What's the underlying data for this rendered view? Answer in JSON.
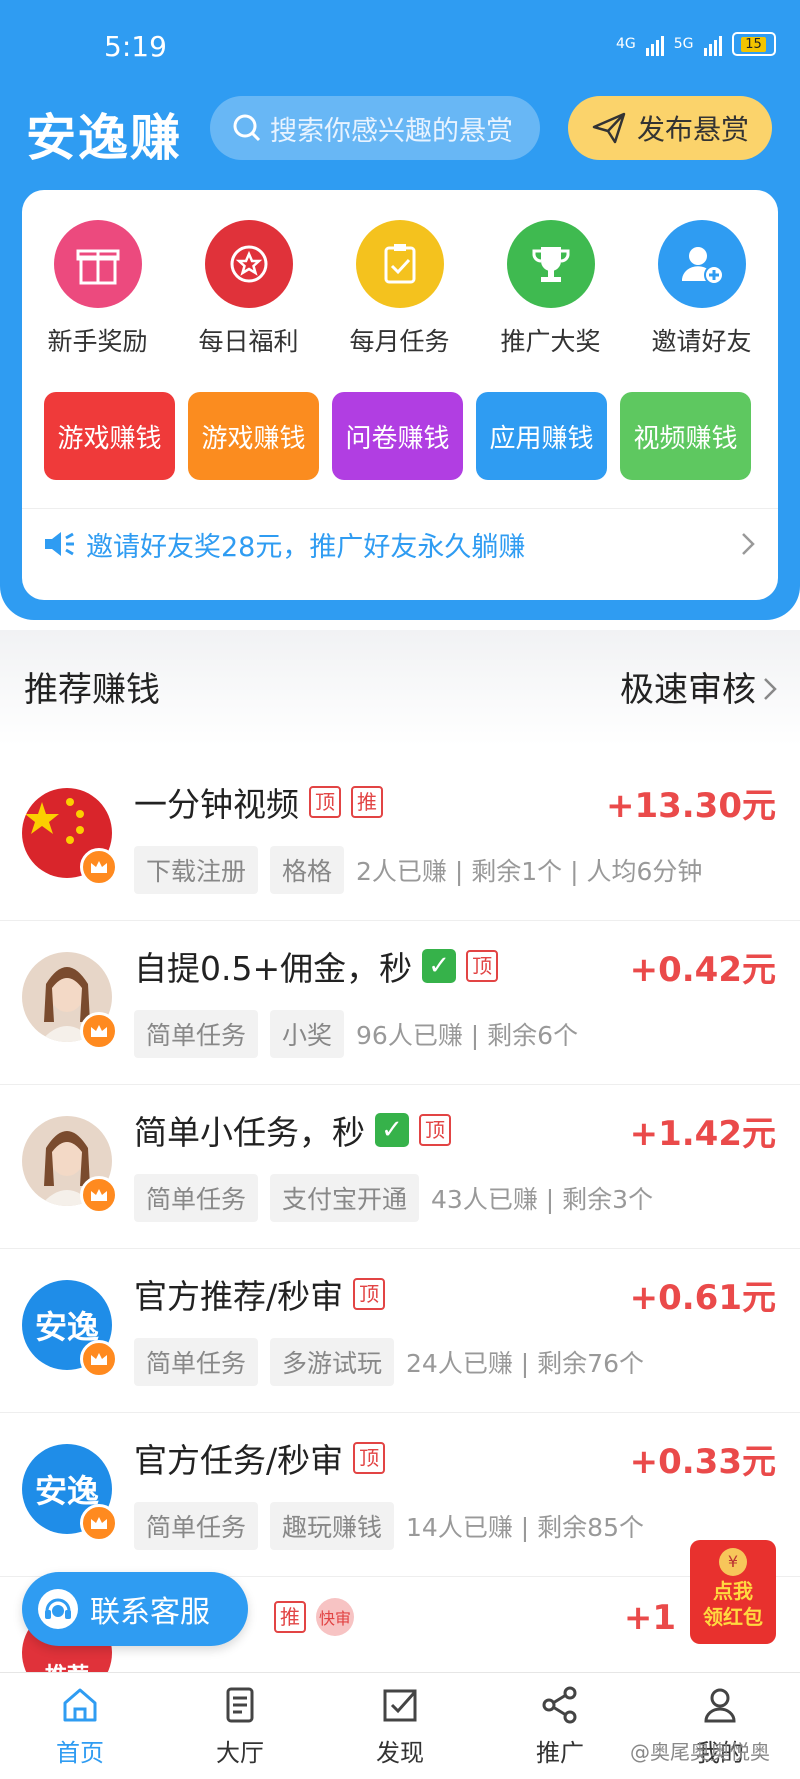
{
  "status_bar": {
    "time": "5:19",
    "battery": "15",
    "net1": "4G",
    "net2": "5G"
  },
  "header": {
    "logo": "安逸赚",
    "search_placeholder": "搜索你感兴趣的悬赏",
    "publish_label": "发布悬赏"
  },
  "quick_icons": [
    {
      "label": "新手奖励",
      "icon": "gift-icon",
      "color": "#ec4a7e"
    },
    {
      "label": "每日福利",
      "icon": "star-badge-icon",
      "color": "#e0323a"
    },
    {
      "label": "每月任务",
      "icon": "clipboard-check-icon",
      "color": "#f4c21e"
    },
    {
      "label": "推广大奖",
      "icon": "trophy-icon",
      "color": "#3fba50"
    },
    {
      "label": "邀请好友",
      "icon": "add-user-icon",
      "color": "#2f9cf2"
    }
  ],
  "category_tags": [
    {
      "label": "游戏赚钱",
      "color": "#ef3a3a"
    },
    {
      "label": "游戏赚钱",
      "color": "#fb8c1f"
    },
    {
      "label": "问卷赚钱",
      "color": "#b13ee2"
    },
    {
      "label": "应用赚钱",
      "color": "#2f9cf2"
    },
    {
      "label": "视频赚钱",
      "color": "#5ec860"
    }
  ],
  "notice": "邀请好友奖28元，推广好友永久躺赚",
  "section": {
    "title": "推荐赚钱",
    "right": "极速审核"
  },
  "tasks": [
    {
      "title": "一分钟视频",
      "check": false,
      "badges": [
        "顶",
        "推"
      ],
      "price": "+13.30元",
      "chips": [
        "下载注册",
        "格格"
      ],
      "stat": "2人已赚 | 剩余1个 | 人均6分钟",
      "avatar": "flag"
    },
    {
      "title": "自提0.5+佣金，秒",
      "check": true,
      "badges": [
        "顶"
      ],
      "price": "+0.42元",
      "chips": [
        "简单任务",
        "小奖"
      ],
      "stat": "96人已赚 | 剩余6个",
      "avatar": "girl"
    },
    {
      "title": "简单小任务，秒",
      "check": true,
      "badges": [
        "顶"
      ],
      "price": "+1.42元",
      "chips": [
        "简单任务",
        "支付宝开通"
      ],
      "stat": "43人已赚 | 剩余3个",
      "avatar": "girl"
    },
    {
      "title": "官方推荐/秒审",
      "check": false,
      "badges": [
        "顶"
      ],
      "price": "+0.61元",
      "chips": [
        "简单任务",
        "多游试玩"
      ],
      "stat": "24人已赚 | 剩余76个",
      "avatar": "logo"
    },
    {
      "title": "官方任务/秒审",
      "check": false,
      "badges": [
        "顶"
      ],
      "price": "+0.33元",
      "chips": [
        "简单任务",
        "趣玩赚钱"
      ],
      "stat": "14人已赚 | 剩余85个",
      "avatar": "logo"
    }
  ],
  "partial_row": {
    "badge": "推",
    "fast": "快审",
    "price_prefix": "+1",
    "avatar_text": "推荐"
  },
  "avatar_logo_text": "安逸",
  "customer_service": "联系客服",
  "red_packet": {
    "line1": "点我",
    "line2": "领红包",
    "coin": "¥"
  },
  "nav": [
    {
      "label": "首页",
      "icon": "home-icon",
      "active": true
    },
    {
      "label": "大厅",
      "icon": "document-icon",
      "active": false
    },
    {
      "label": "发现",
      "icon": "check-square-icon",
      "active": false
    },
    {
      "label": "推广",
      "icon": "share-icon",
      "active": false
    },
    {
      "label": "我的",
      "icon": "user-icon",
      "active": false
    }
  ],
  "watermark": "@奥尾奥奥悦奥"
}
